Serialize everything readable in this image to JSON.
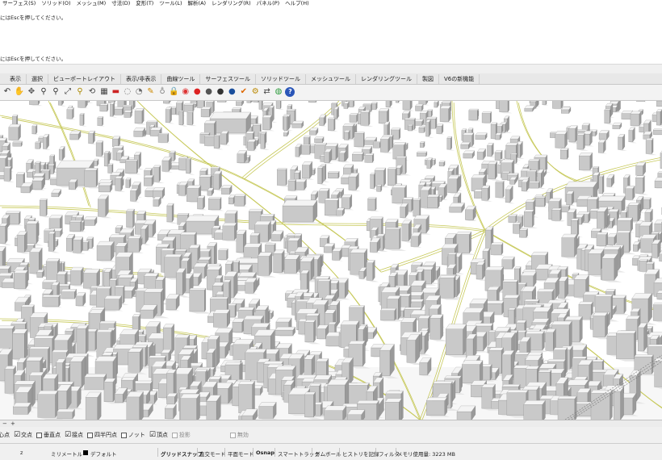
{
  "menubar": {
    "items": [
      "サーフェス(S)",
      "ソリッド(O)",
      "メッシュ(M)",
      "寸法(D)",
      "変形(T)",
      "ツール(L)",
      "解析(A)",
      "レンダリング(R)",
      "パネル(P)",
      "ヘルプ(H)"
    ]
  },
  "command_history": {
    "line1": "にはEscを押してください。",
    "line2": "にはEscを押してください。"
  },
  "tabs": [
    "表示",
    "選択",
    "ビューポートレイアウト",
    "表示/非表示",
    "曲線ツール",
    "サーフェスツール",
    "ソリッドツール",
    "メッシュツール",
    "レンダリングツール",
    "製図",
    "V6の新機能"
  ],
  "toolbar": {
    "icons": [
      "undo-icon",
      "pan-hand-icon",
      "move-icon",
      "zoom-icon",
      "zoom-window-icon",
      "zoom-extents-icon",
      "zoom-selected-icon",
      "rotate-view-icon",
      "grid-viewports-icon",
      "red-cap-icon",
      "wireframe-icon",
      "redo-view-icon",
      "named-view-icon",
      "light-icon",
      "lock-icon",
      "color-wheel-icon",
      "render-sphere-icon",
      "material-sphere-icon",
      "shaded-sphere-icon",
      "dark-sphere-icon",
      "highlight-icon",
      "gears-icon",
      "connector-icon",
      "globe-icon",
      "help-icon"
    ]
  },
  "viewport_bar": {
    "minus_icon": "−",
    "plus_icon": "+"
  },
  "osnap": {
    "items": [
      {
        "label": "心点",
        "checked": false,
        "partial": true,
        "disabled": false
      },
      {
        "label": "交点",
        "checked": true,
        "disabled": false
      },
      {
        "label": "垂直点",
        "checked": false,
        "disabled": false
      },
      {
        "label": "接点",
        "checked": true,
        "disabled": false
      },
      {
        "label": "四半円点",
        "checked": false,
        "disabled": false
      },
      {
        "label": "ノット",
        "checked": false,
        "disabled": false
      },
      {
        "label": "頂点",
        "checked": true,
        "disabled": false
      },
      {
        "label": "投影",
        "checked": false,
        "disabled": true
      },
      {
        "label": "無効",
        "checked": false,
        "disabled": true
      }
    ],
    "check_mark": "☑"
  },
  "statusbar": {
    "z_label": "z",
    "units": "ミリメートル",
    "layer": "デフォルト",
    "layer_color": "#000000",
    "grid_snap": "グリッドスナップ",
    "ortho": "直交モード",
    "planar": "平面モード",
    "osnap": "Osnap",
    "smarttrack": "スマートトラック",
    "gumball": "ガムボール",
    "history": "ヒストリを記録",
    "filter": "フィルタ",
    "memory": "メモリ使用量: 3223 MB"
  },
  "colors": {
    "road_line": "#c7c95a",
    "building_top": "#f4f4f4",
    "building_side": "#9a9a9a",
    "ground": "#ffffff"
  }
}
